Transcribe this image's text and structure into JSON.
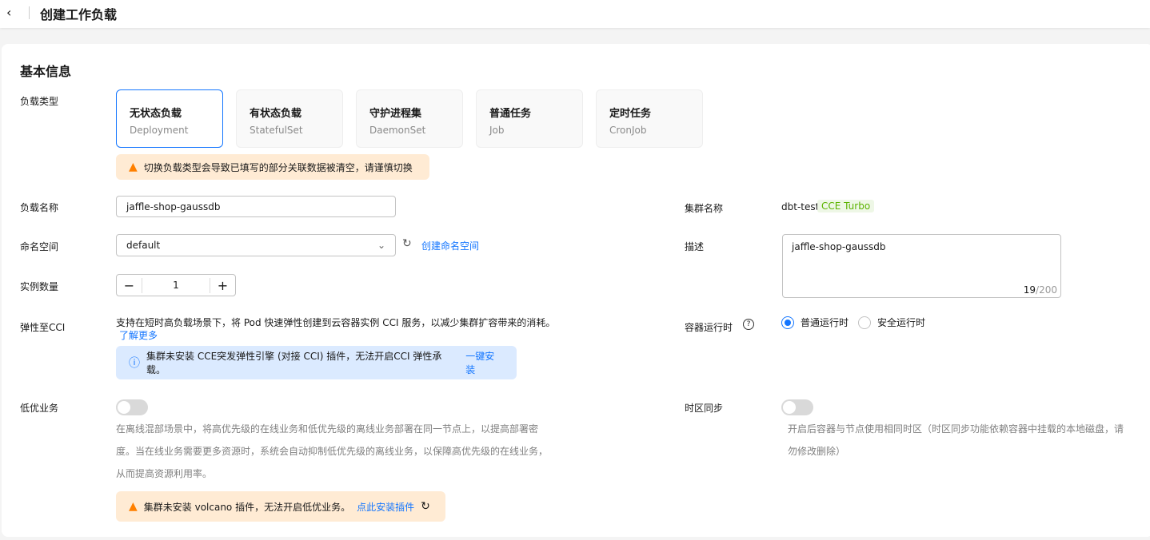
{
  "header": {
    "title": "创建工作负载",
    "back_icon": "chevron-left-icon"
  },
  "section_title": "基本信息",
  "workload_type": {
    "label": "负载类型",
    "options": [
      {
        "title": "无状态负载",
        "sub": "Deployment",
        "selected": true
      },
      {
        "title": "有状态负载",
        "sub": "StatefulSet"
      },
      {
        "title": "守护进程集",
        "sub": "DaemonSet"
      },
      {
        "title": "普通任务",
        "sub": "Job"
      },
      {
        "title": "定时任务",
        "sub": "CronJob"
      }
    ],
    "warning": "切换负载类型会导致已填写的部分关联数据被清空，请谨慎切换"
  },
  "name": {
    "label": "负载名称",
    "value": "jaffle-shop-gaussdb"
  },
  "namespace": {
    "label": "命名空间",
    "value": "default",
    "create_link": "创建命名空间"
  },
  "replicas": {
    "label": "实例数量",
    "value": "1"
  },
  "cci": {
    "label": "弹性至CCI",
    "desc": "支持在短时高负载场景下，将 Pod 快速弹性创建到云容器实例 CCI 服务，以减少集群扩容带来的消耗。",
    "learn_more": "了解更多",
    "info": "集群未安装 CCE突发弹性引擎 (对接 CCI) 插件，无法开启CCI 弹性承载。",
    "install": "一键安装"
  },
  "low_priority": {
    "label": "低优业务",
    "enabled": false,
    "desc": "在离线混部场景中，将高优先级的在线业务和低优先级的离线业务部署在同一节点上，以提高部署密度。当在线业务需要更多资源时，系统会自动抑制低优先级的离线业务，以保障高优先级的在线业务，从而提高资源利用率。",
    "warning": "集群未安装 volcano 插件，无法开启低优业务。",
    "install": "点此安装插件"
  },
  "cluster": {
    "label": "集群名称",
    "value": "dbt-test",
    "badge": "CCE Turbo"
  },
  "description": {
    "label": "描述",
    "value": "jaffle-shop-gaussdb",
    "count": "19",
    "max": "/200"
  },
  "runtime": {
    "label": "容器运行时",
    "options": [
      "普通运行时",
      "安全运行时"
    ],
    "selected": "普通运行时"
  },
  "timezone": {
    "label": "时区同步",
    "enabled": false,
    "desc": "开启后容器与节点使用相同时区（时区同步功能依赖容器中挂载的本地磁盘，请勿修改删除）"
  },
  "colors": {
    "primary": "#1476ff",
    "warning_bg": "#ffebd4",
    "info_bg": "#dbeaff",
    "badge": "#5cb300"
  }
}
